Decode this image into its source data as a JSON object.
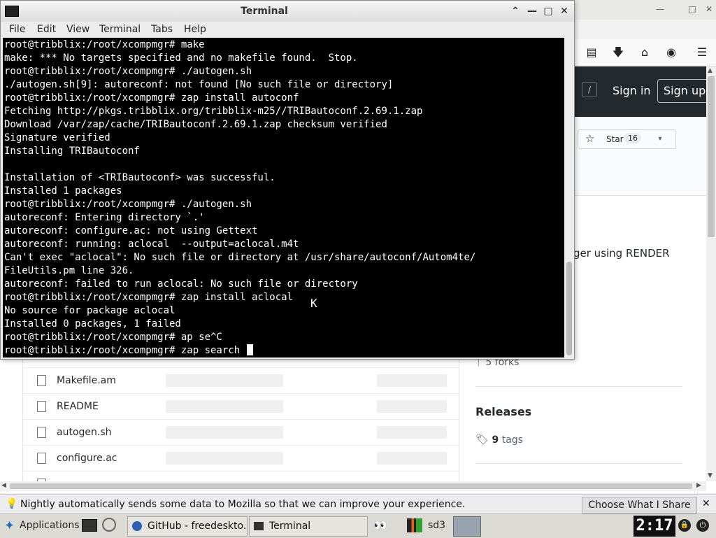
{
  "terminal": {
    "title": "Terminal",
    "menu": [
      "File",
      "Edit",
      "View",
      "Terminal",
      "Tabs",
      "Help"
    ],
    "lines": [
      "root@tribblix:/root/xcompmgr# make",
      "make: *** No targets specified and no makefile found.  Stop.",
      "root@tribblix:/root/xcompmgr# ./autogen.sh",
      "./autogen.sh[9]: autoreconf: not found [No such file or directory]",
      "root@tribblix:/root/xcompmgr# zap install autoconf",
      "Fetching http://pkgs.tribblix.org/tribblix-m25//TRIBautoconf.2.69.1.zap",
      "Download /var/zap/cache/TRIBautoconf.2.69.1.zap checksum verified",
      "Signature verified",
      "Installing TRIBautoconf",
      "",
      "Installation of <TRIBautoconf> was successful.",
      "Installed 1 packages",
      "root@tribblix:/root/xcompmgr# ./autogen.sh",
      "autoreconf: Entering directory `.'",
      "autoreconf: configure.ac: not using Gettext",
      "autoreconf: running: aclocal  --output=aclocal.m4t",
      "Can't exec \"aclocal\": No such file or directory at /usr/share/autoconf/Autom4te/",
      "FileUtils.pm line 326.",
      "autoreconf: failed to run aclocal: No such file or directory",
      "root@tribblix:/root/xcompmgr# zap install aclocal",
      "No source for package aclocal",
      "Installed 0 packages, 1 failed",
      "root@tribblix:/root/xcompmgr# ap se^C"
    ],
    "prompt_line": "root@tribblix:/root/xcompmgr# zap search "
  },
  "browser": {
    "header": {
      "search_slash": "/",
      "sign_in": "Sign in",
      "sign_up": "Sign up"
    },
    "repo": {
      "star_label": "Star",
      "star_count": "16"
    },
    "about_fragment": "ger using RENDER",
    "forks": "5 forks",
    "releases": {
      "title": "Releases",
      "tags_count": "9",
      "tags_label": "tags"
    },
    "files": [
      "Makefile.am",
      "README",
      "autogen.sh",
      "configure.ac"
    ]
  },
  "notification": {
    "text": "Nightly automatically sends some data to Mozilla so that we can improve your experience.",
    "button": "Choose What I Share"
  },
  "taskbar": {
    "applications": "Applications",
    "tasks": [
      "GitHub - freedeskto...",
      "Terminal"
    ],
    "workspace": "sd3",
    "clock": "2:17"
  },
  "colors": {
    "github_header": "#24292e",
    "terminal_bg": "#000000",
    "terminal_fg": "#ffffff"
  }
}
